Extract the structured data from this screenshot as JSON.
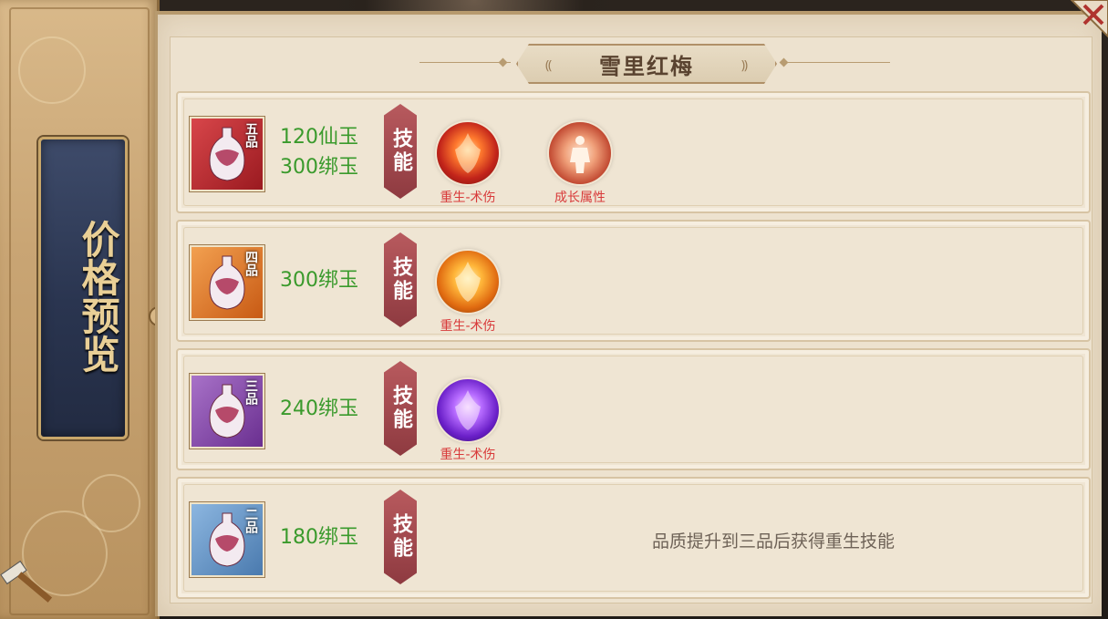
{
  "panel": {
    "title": "价格预览"
  },
  "header": {
    "title": "雪里红梅"
  },
  "rows": [
    {
      "grade": "五品",
      "prices": [
        "120仙玉",
        "300绑玉"
      ],
      "skill_tag": "技能",
      "skills": [
        "重生-术伤",
        "成长属性"
      ],
      "icon_color": "#c0282e"
    },
    {
      "grade": "四品",
      "prices": [
        "300绑玉"
      ],
      "skill_tag": "技能",
      "skills": [
        "重生-术伤"
      ],
      "icon_color": "#e2772a"
    },
    {
      "grade": "三品",
      "prices": [
        "240绑玉"
      ],
      "skill_tag": "技能",
      "skills": [
        "重生-术伤"
      ],
      "icon_color": "#8a4fb0"
    },
    {
      "grade": "二品",
      "prices": [
        "180绑玉"
      ],
      "skill_tag": "技能",
      "skills": [],
      "note": "品质提升到三品后获得重生技能",
      "icon_color": "#5d8ec0"
    }
  ],
  "colors": {
    "price_green": "#3a9a2c",
    "skill_label_red": "#d83a3a",
    "plaque_navy": "#2a3550"
  },
  "icons": [
    "close-icon",
    "brush-icon",
    "vase-icon",
    "rebirth-skill-icon",
    "growth-attribute-icon"
  ]
}
